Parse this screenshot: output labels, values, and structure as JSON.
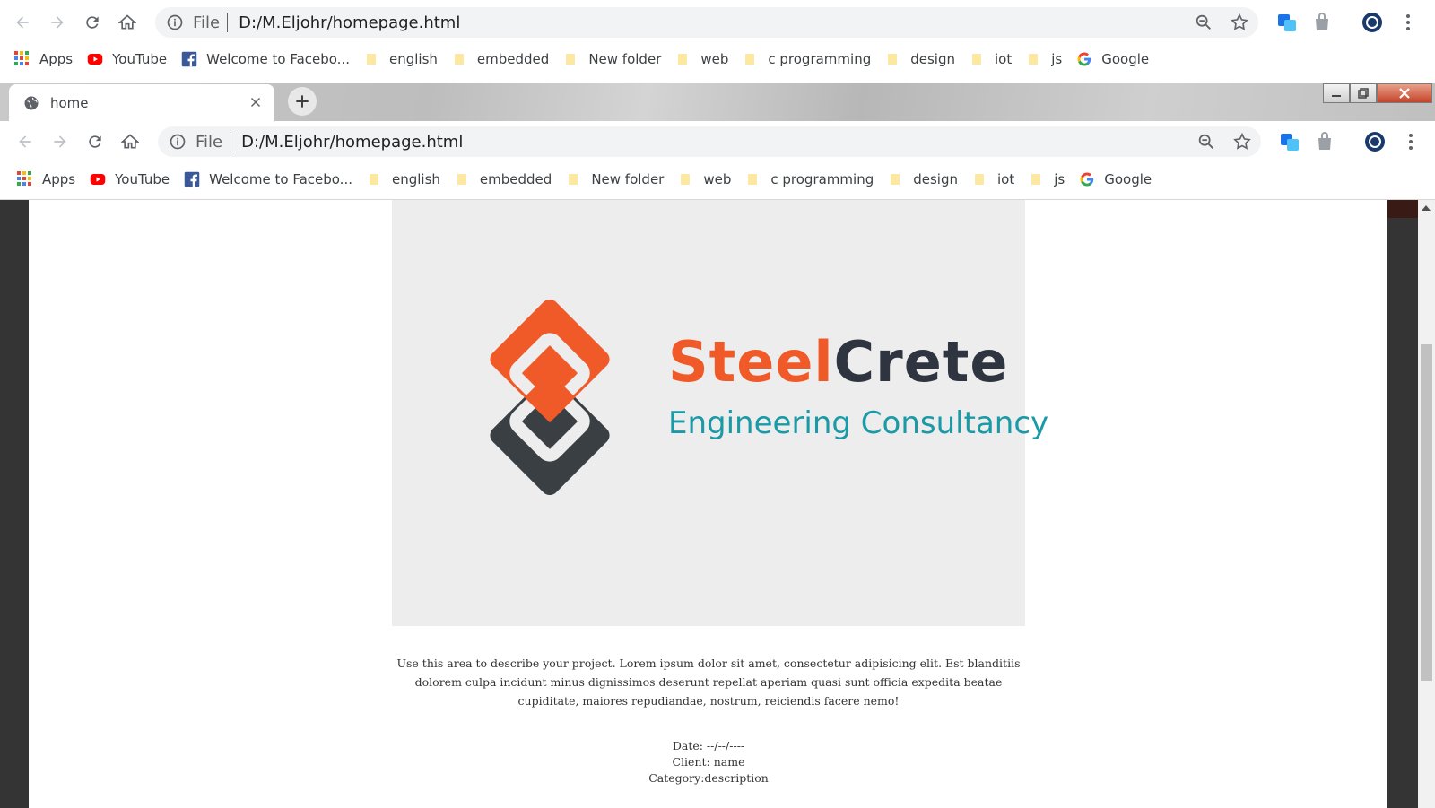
{
  "outer_browser": {
    "url_scheme": "File",
    "url": "D:/M.Eljohr/homepage.html"
  },
  "inner_browser": {
    "tab": {
      "title": "home"
    },
    "url_scheme": "File",
    "url": "D:/M.Eljohr/homepage.html"
  },
  "bookmarks": [
    {
      "label": "Apps",
      "icon": "apps-grid-icon"
    },
    {
      "label": "YouTube",
      "icon": "youtube-icon"
    },
    {
      "label": "Welcome to Facebo...",
      "icon": "facebook-icon"
    },
    {
      "label": "english",
      "icon": "folder-icon"
    },
    {
      "label": "embedded",
      "icon": "folder-icon"
    },
    {
      "label": "New folder",
      "icon": "folder-icon"
    },
    {
      "label": "web",
      "icon": "folder-icon"
    },
    {
      "label": "c programming",
      "icon": "folder-icon"
    },
    {
      "label": "design",
      "icon": "folder-icon"
    },
    {
      "label": "iot",
      "icon": "folder-icon"
    },
    {
      "label": "js",
      "icon": "folder-icon"
    },
    {
      "label": "Google",
      "icon": "google-icon"
    }
  ],
  "project": {
    "logo_word_1": "Steel",
    "logo_word_2": "Crete",
    "logo_subtitle": "Engineering Consultancy",
    "description": "Use this area to describe your project. Lorem ipsum dolor sit amet, consectetur adipisicing elit. Est blanditiis dolorem culpa incidunt minus dignissimos deserunt repellat aperiam quasi sunt officia expedita beatae cupiditate, maiores repudiandae, nostrum, reiciendis facere nemo!",
    "date": "Date: --/--/----",
    "client": "Client: name",
    "category": "Category:description"
  },
  "colors": {
    "brand_orange": "#f05a28",
    "brand_dark": "#2e3440",
    "brand_teal": "#1a9aa6",
    "page_sidebar": "#343434"
  }
}
